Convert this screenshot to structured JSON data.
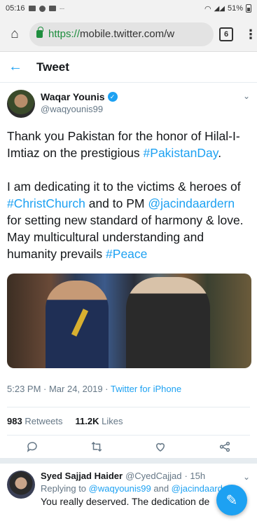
{
  "status_bar": {
    "time": "05:16",
    "battery": "51%"
  },
  "browser": {
    "url_scheme": "https://",
    "url_rest": "mobile.twitter.com/w",
    "tab_count": "6"
  },
  "header": {
    "title": "Tweet"
  },
  "tweet": {
    "author_name": "Waqar Younis",
    "author_handle": "@waqyounis99",
    "p1_a": "Thank you Pakistan for the honor of Hilal-I-Imtiaz on the prestigious ",
    "p1_link": "#PakistanDay",
    "p1_b": ".",
    "p2_a": "I am dedicating it to the victims & heroes of ",
    "p2_link1": "#ChristChurch",
    "p2_b": " and to PM ",
    "p2_link2": "@jacindaardern",
    "p2_c": " for setting new standard of harmony & love. May multicultural understanding and humanity prevails ",
    "p2_link3": "#Peace",
    "timestamp": "5:23 PM · Mar 24, 2019 · ",
    "source": "Twitter for iPhone",
    "retweets_count": "983",
    "retweets_label": "Retweets",
    "likes_count": "11.2K",
    "likes_label": "Likes"
  },
  "reply": {
    "name": "Syed Sajjad Haider",
    "handle": "@CyedCajjad",
    "time": "· 15h",
    "replying_prefix": "Replying to ",
    "replying_to1": "@waqyounis99",
    "replying_and": " and ",
    "replying_to2": "@jacindaarde",
    "text": "You really deserved. The dedication de"
  },
  "icons": {
    "home": "home-icon",
    "back": "back-arrow-icon",
    "reply": "reply-icon",
    "retweet": "retweet-icon",
    "like": "heart-icon",
    "share": "share-icon",
    "compose": "compose-icon"
  },
  "colors": {
    "accent": "#1da1f2",
    "secure": "#1e8e3e",
    "muted": "#657786"
  }
}
